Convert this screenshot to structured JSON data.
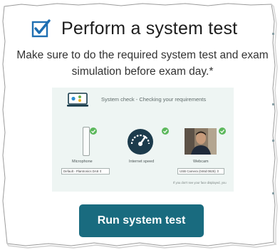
{
  "header": {
    "title": "Perform a system test",
    "icon": "checked-box-icon"
  },
  "subtitle": "Make sure to do the required system test and exam simulation before exam day.*",
  "system_check": {
    "title": "System check - Checking your requirements",
    "microphone_label": "Microphone",
    "microphone_select": "Default - Plantronics DA8 ⇕",
    "internet_label": "Internet speed",
    "webcam_label": "Webcam",
    "webcam_select": "USB Camera (046d:0825) ⇕",
    "hint": "If you don't see your face displayed, you"
  },
  "primary_button": {
    "label": "Run system test"
  },
  "colors": {
    "accent": "#196b7f",
    "check_green": "#5cb85c",
    "checkbox_blue": "#1f6fb2",
    "panel_bg": "#eef5f3"
  }
}
